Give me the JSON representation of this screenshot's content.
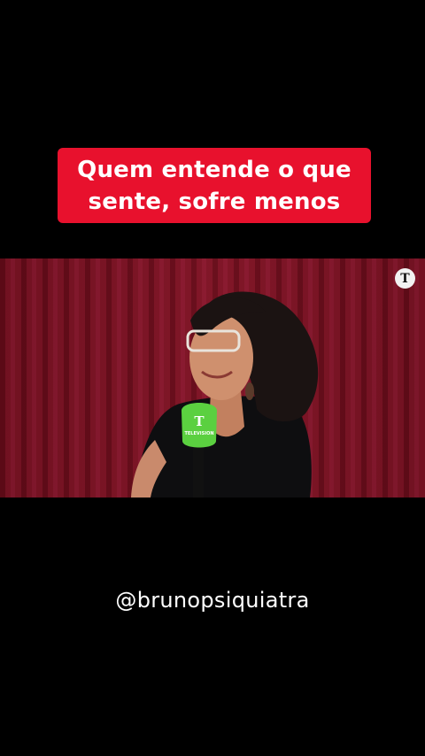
{
  "caption": {
    "line1": "Quem entende o que",
    "line2": "sente, sofre menos"
  },
  "video": {
    "logo_letter": "T",
    "mic_flag_text": "T",
    "mic_flag_subtext": "TELEVISION"
  },
  "handle": "@brunopsiquiatra",
  "colors": {
    "caption_bg": "#e8112d",
    "curtain": "#7a1424",
    "mic_flag": "#5bd040"
  }
}
